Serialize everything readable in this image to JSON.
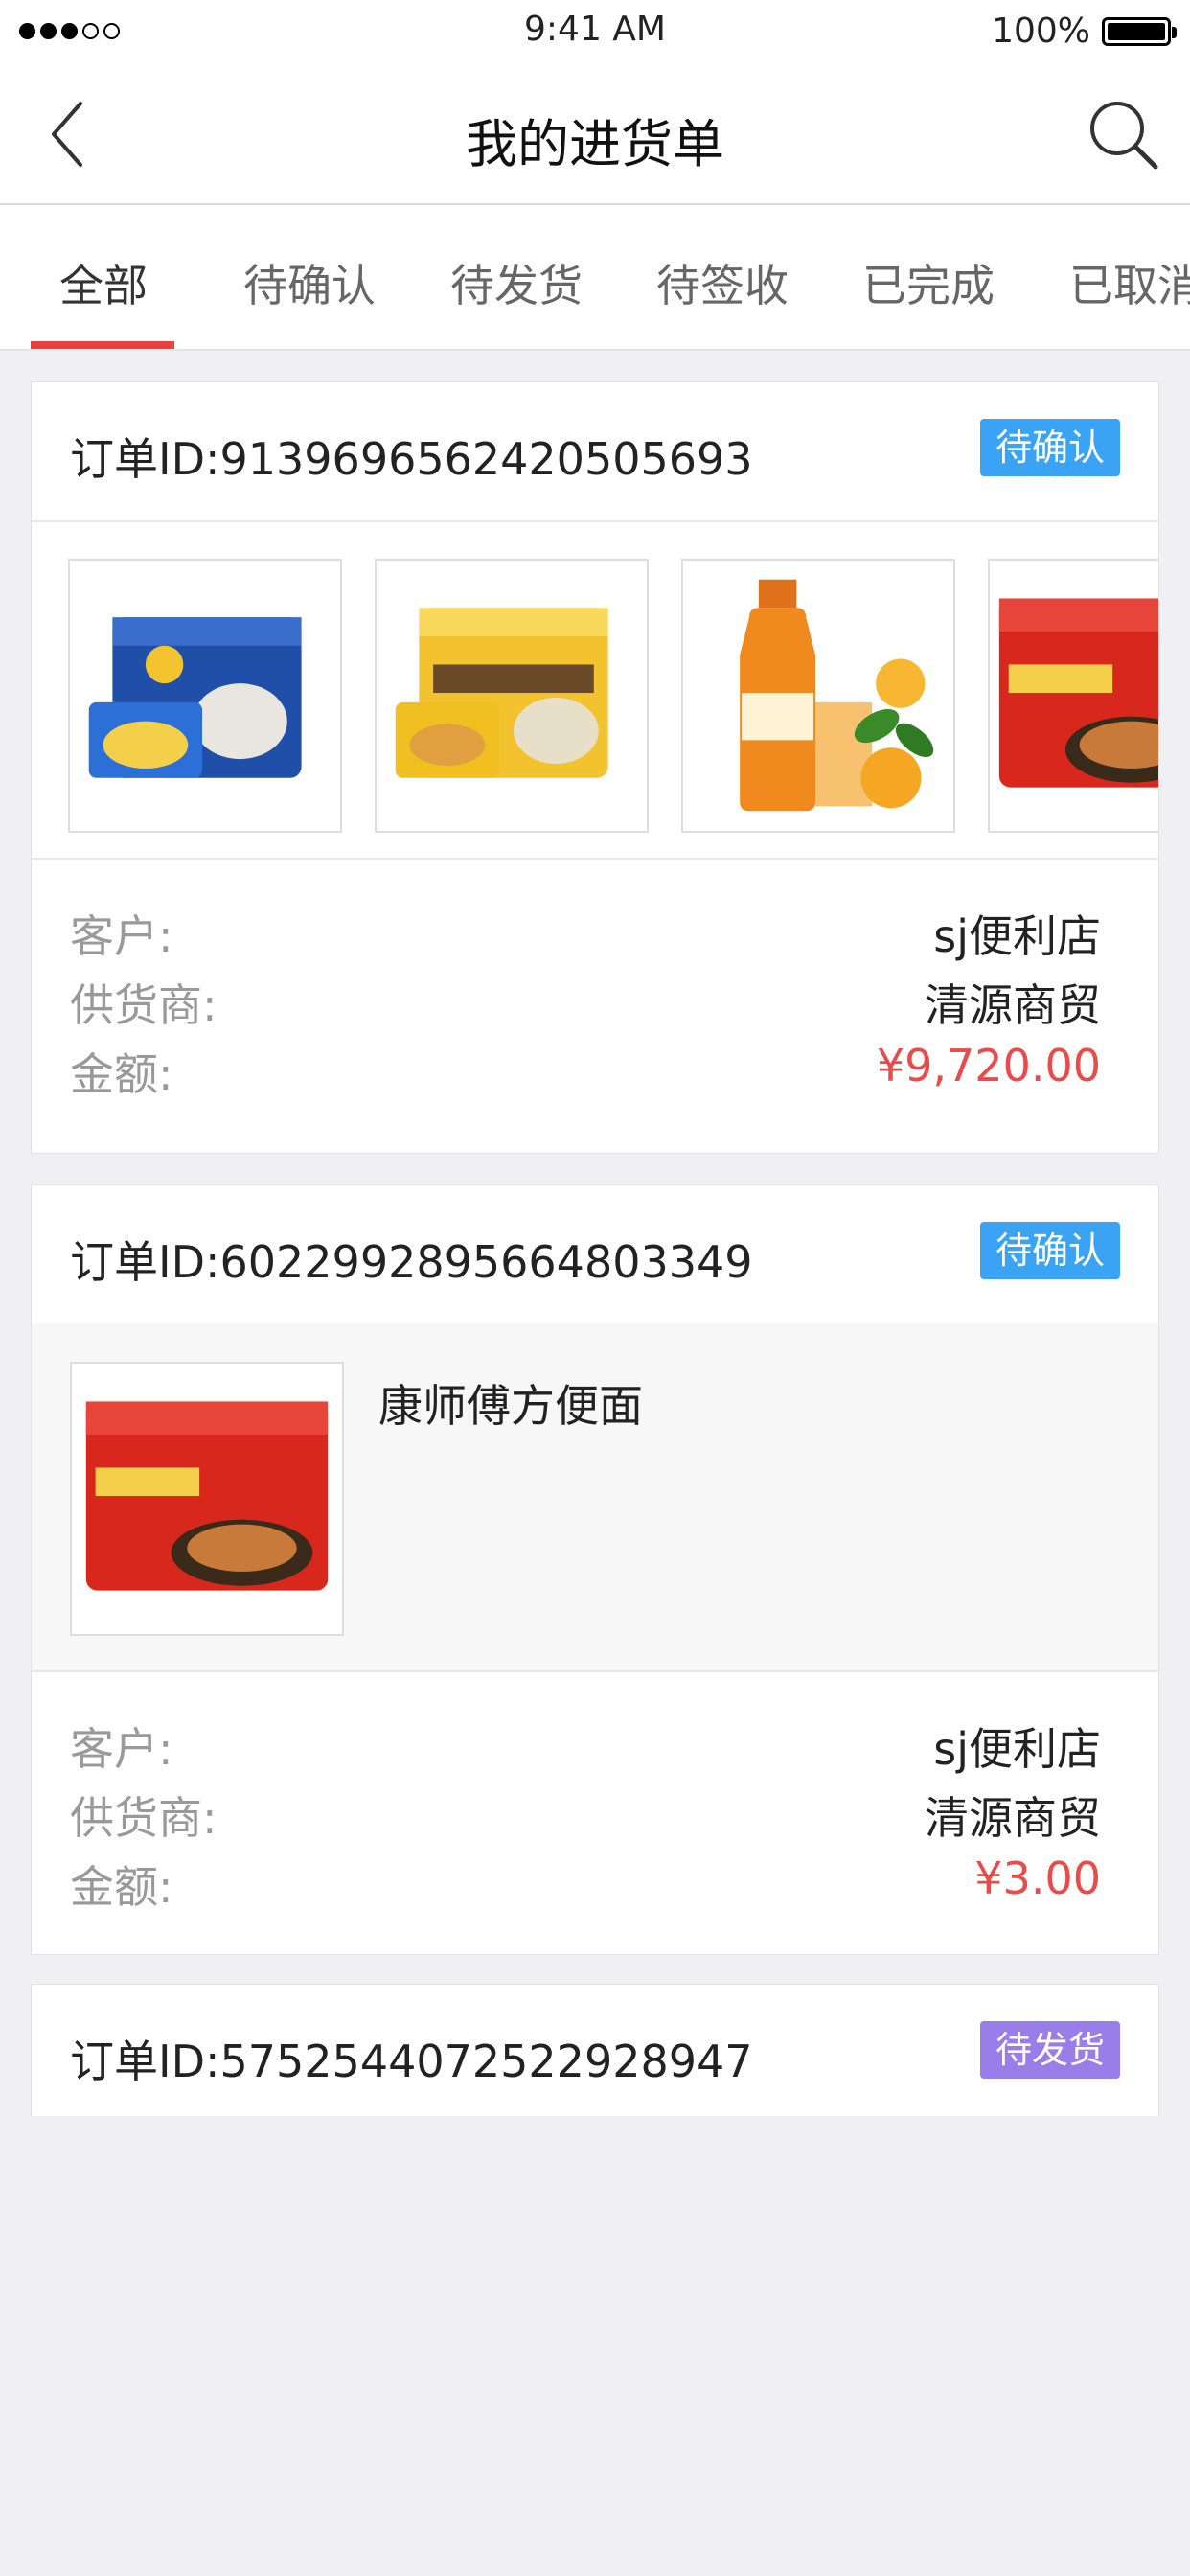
{
  "status_bar": {
    "time": "9:41 AM",
    "battery": "100%",
    "battery_level": 1.0,
    "signal_bars_filled": 3,
    "signal_bars_total": 5
  },
  "nav": {
    "title": "我的进货单",
    "back_icon": "back-chevron-icon",
    "search_icon": "search-icon"
  },
  "tabs": [
    {
      "label": "全部",
      "active": true
    },
    {
      "label": "待确认",
      "active": false
    },
    {
      "label": "待发货",
      "active": false
    },
    {
      "label": "待签收",
      "active": false
    },
    {
      "label": "已完成",
      "active": false
    },
    {
      "label": "已取消",
      "active": false
    }
  ],
  "labels": {
    "customer": "客户:",
    "supplier": "供货商:",
    "amount": "金额:"
  },
  "orders": [
    {
      "order_label": "订单ID:9139696562420505693",
      "status": "待确认",
      "status_color": "#3aa3f3",
      "products": [
        {
          "kind": "blue-noodle-pack"
        },
        {
          "kind": "yellow-noodle-pack"
        },
        {
          "kind": "orange-juice-bottle"
        },
        {
          "kind": "red-noodle-pack"
        }
      ],
      "customer": "sj便利店",
      "supplier": "清源商贸",
      "amount": "¥9,720.00"
    },
    {
      "order_label": "订单ID:6022992895664803349",
      "status": "待确认",
      "status_color": "#3aa3f3",
      "product_name": "康师傅方便面",
      "customer": "sj便利店",
      "supplier": "清源商贸",
      "amount": "¥3.00"
    },
    {
      "order_label": "订单ID:5752544072522928947",
      "status": "待发货",
      "status_color": "#9a7de9"
    }
  ],
  "colors": {
    "accent": "#e8403f",
    "amount": "#e94a4a",
    "badge_confirm": "#3aa3f3",
    "badge_ship": "#9a7de9",
    "background": "#efeff4"
  }
}
